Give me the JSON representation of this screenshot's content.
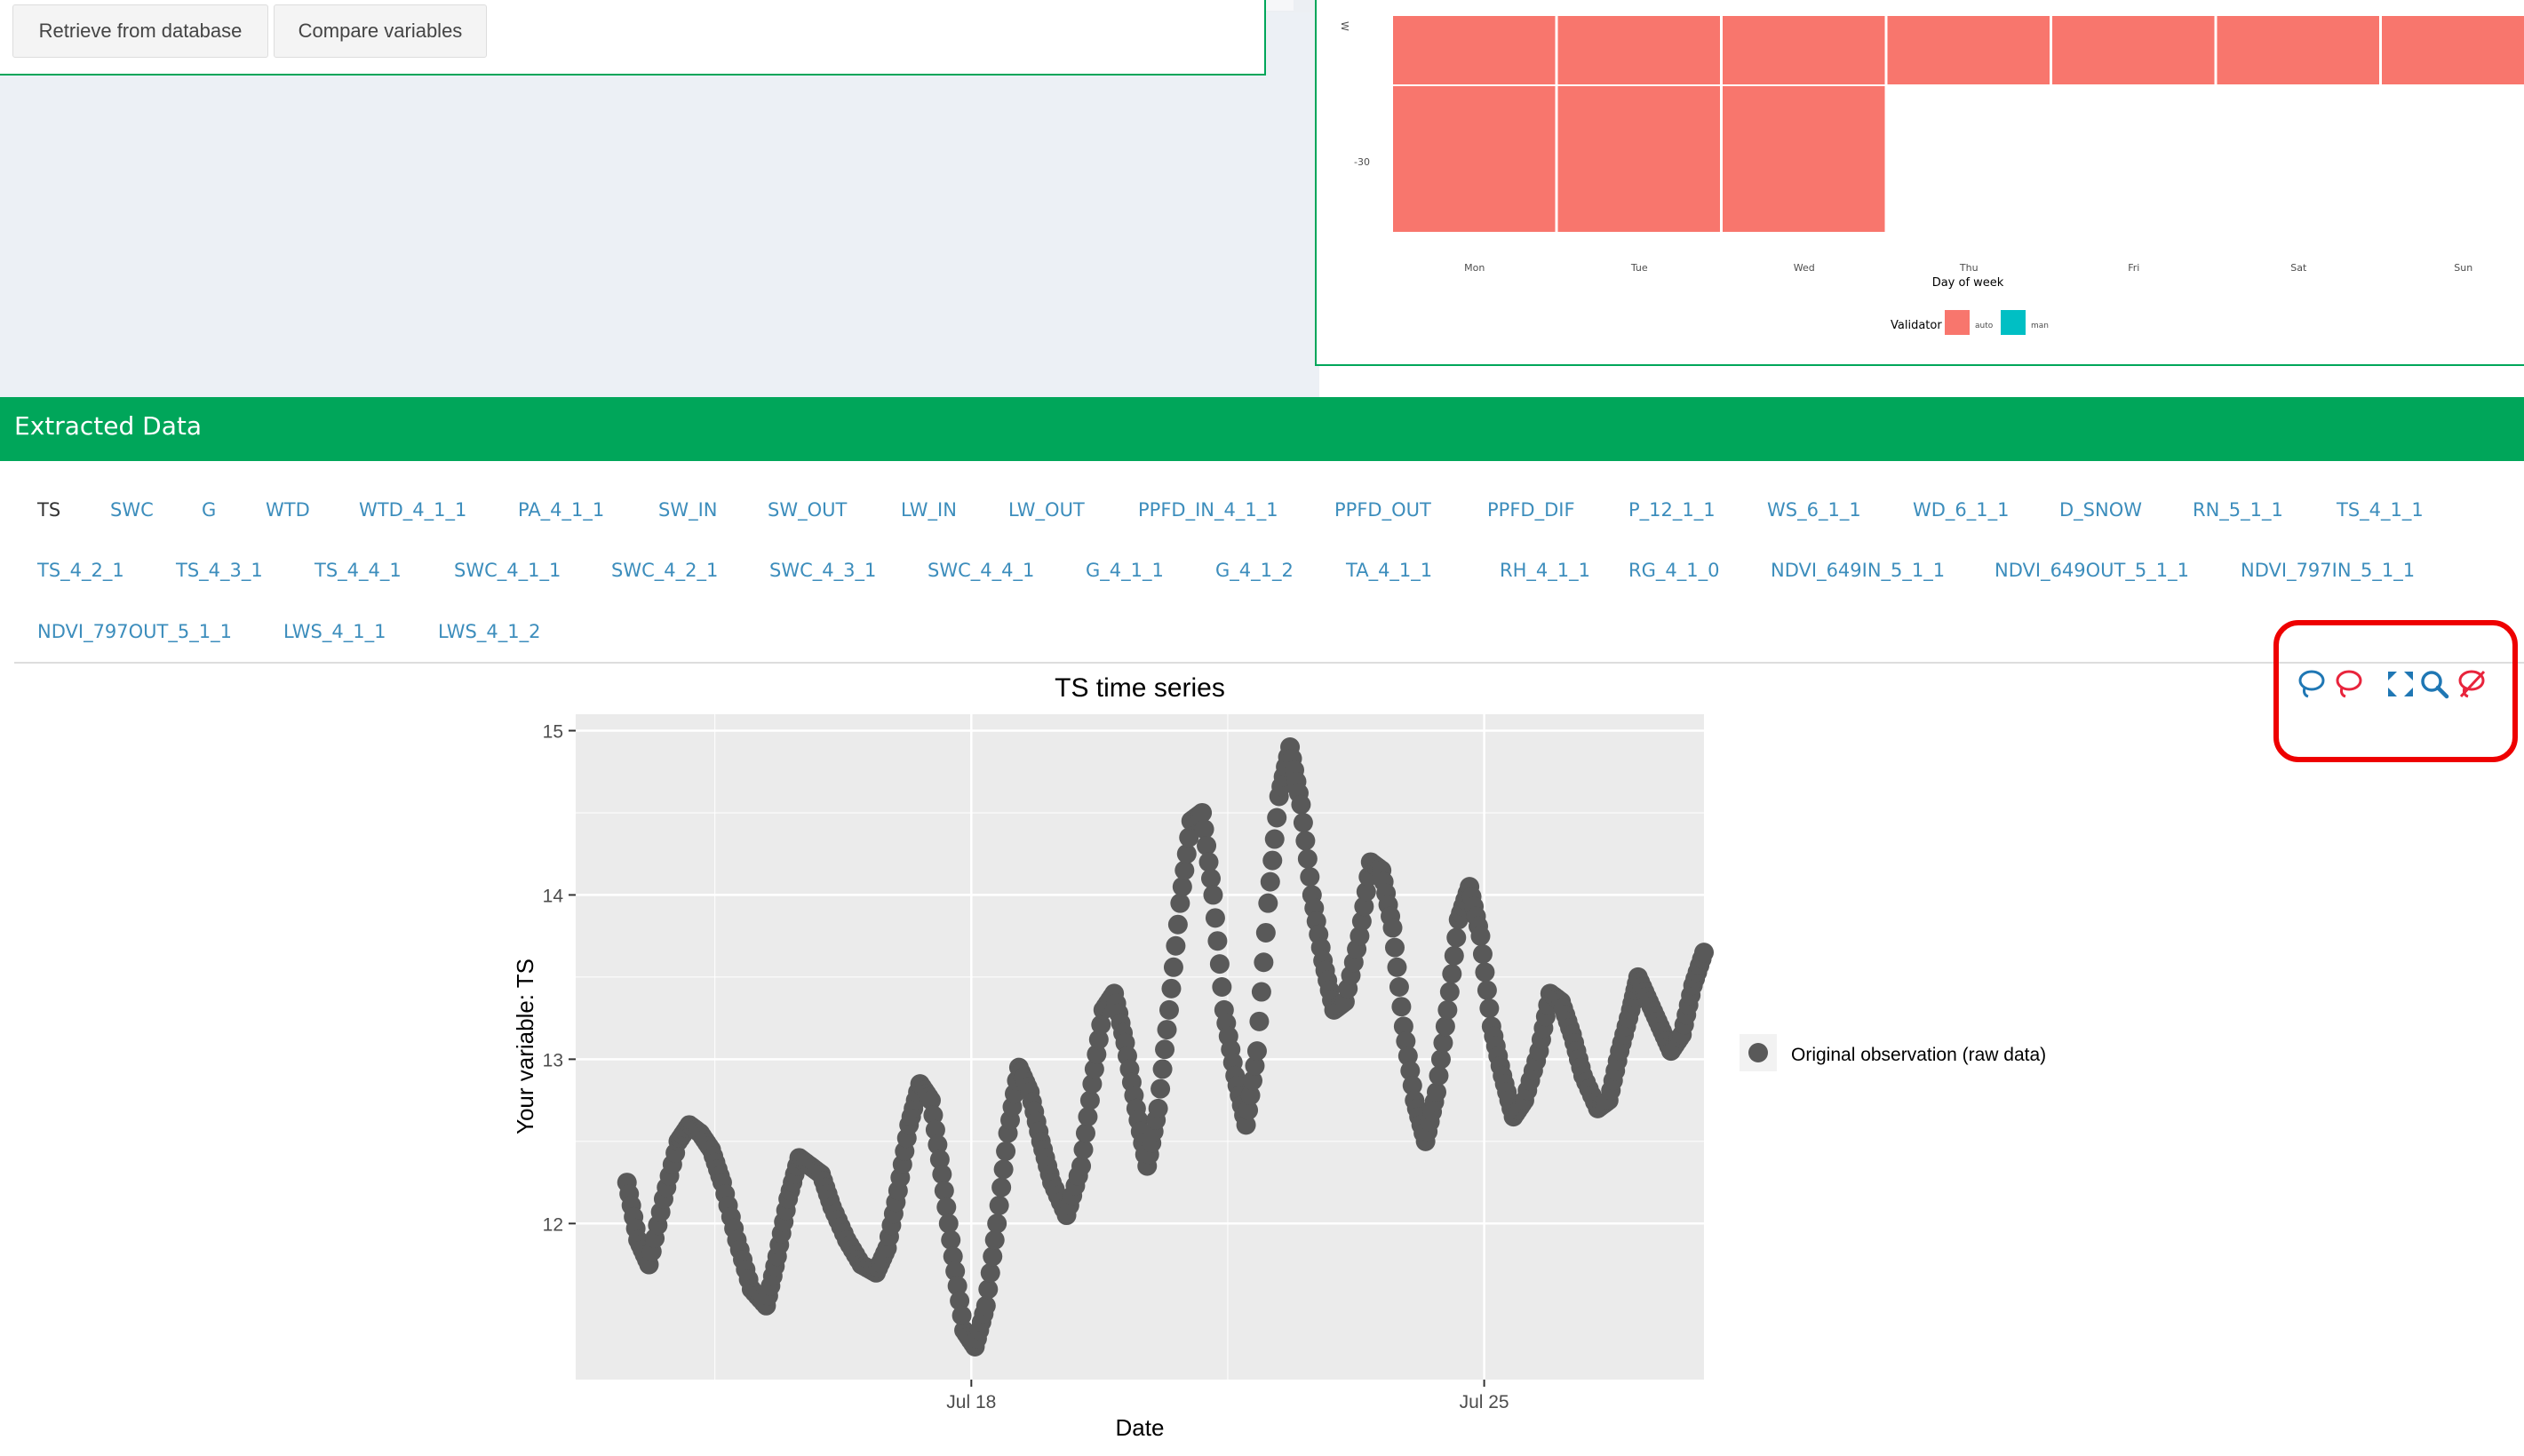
{
  "buttons": {
    "retrieve": "Retrieve from database",
    "compare": "Compare variables"
  },
  "heatmap": {
    "xlabel": "Day of week",
    "days": [
      "Mon",
      "Tue",
      "Wed",
      "Thu",
      "Fri",
      "Sat",
      "Sun"
    ],
    "ytick": "-30",
    "legend_title": "Validator",
    "legend_items": [
      {
        "label": "auto",
        "color": "#f8766d"
      },
      {
        "label": "man",
        "color": "#00bfc4"
      }
    ],
    "cell_color": "#f8766d"
  },
  "section": {
    "title": "Extracted Data"
  },
  "tabs": {
    "active": "TS",
    "row1": [
      "TS",
      "SWC",
      "G",
      "WTD",
      "WTD_4_1_1",
      "PA_4_1_1",
      "SW_IN",
      "SW_OUT",
      "LW_IN",
      "LW_OUT",
      "PPFD_IN_4_1_1",
      "PPFD_OUT",
      "PPFD_DIF",
      "P_12_1_1",
      "WS_6_1_1",
      "WD_6_1_1",
      "D_SNOW",
      "RN_5_1_1",
      "TS_4_1_1"
    ],
    "row2": [
      "TS_4_2_1",
      "TS_4_3_1",
      "TS_4_4_1",
      "SWC_4_1_1",
      "SWC_4_2_1",
      "SWC_4_3_1",
      "SWC_4_4_1",
      "G_4_1_1",
      "G_4_1_2",
      "TA_4_1_1",
      "RH_4_1_1",
      "RG_4_1_0",
      "NDVI_649IN_5_1_1",
      "NDVI_649OUT_5_1_1",
      "NDVI_797IN_5_1_1"
    ],
    "row3": [
      "NDVI_797OUT_5_1_1",
      "LWS_4_1_1",
      "LWS_4_1_2"
    ]
  },
  "toolbar": {
    "icons": [
      "lasso-select-icon",
      "lasso-deselect-icon",
      "autoscale-icon",
      "zoom-icon",
      "reset-selection-icon"
    ],
    "colors": {
      "blue": "#1f77b4",
      "red": "#e8243c"
    }
  },
  "chart_data": {
    "type": "scatter",
    "title": "TS time series",
    "xlabel": "Date",
    "ylabel": "Your variable: TS",
    "x_ticks": [
      "Jul 18",
      "Jul 25"
    ],
    "x_tick_days": [
      18,
      25
    ],
    "xlim": [
      12.6,
      28.0
    ],
    "y_ticks": [
      12,
      13,
      14,
      15
    ],
    "ylim": [
      11.05,
      15.1
    ],
    "point_color": "#595959",
    "legend": {
      "label": "Original observation (raw data)",
      "position": "right"
    },
    "series": [
      {
        "name": "Original observation (raw data)",
        "points": [
          [
            13.3,
            12.25
          ],
          [
            13.45,
            11.9
          ],
          [
            13.6,
            11.75
          ],
          [
            13.8,
            12.15
          ],
          [
            14.0,
            12.5
          ],
          [
            14.15,
            12.6
          ],
          [
            14.3,
            12.55
          ],
          [
            14.45,
            12.45
          ],
          [
            14.6,
            12.25
          ],
          [
            14.8,
            11.9
          ],
          [
            15.0,
            11.6
          ],
          [
            15.2,
            11.5
          ],
          [
            15.35,
            11.8
          ],
          [
            15.5,
            12.15
          ],
          [
            15.65,
            12.4
          ],
          [
            15.8,
            12.35
          ],
          [
            15.95,
            12.3
          ],
          [
            16.1,
            12.1
          ],
          [
            16.3,
            11.9
          ],
          [
            16.5,
            11.75
          ],
          [
            16.7,
            11.7
          ],
          [
            16.85,
            11.85
          ],
          [
            17.0,
            12.2
          ],
          [
            17.15,
            12.6
          ],
          [
            17.3,
            12.85
          ],
          [
            17.45,
            12.75
          ],
          [
            17.6,
            12.3
          ],
          [
            17.75,
            11.8
          ],
          [
            17.9,
            11.35
          ],
          [
            18.05,
            11.25
          ],
          [
            18.2,
            11.5
          ],
          [
            18.35,
            12.0
          ],
          [
            18.5,
            12.55
          ],
          [
            18.65,
            12.95
          ],
          [
            18.8,
            12.8
          ],
          [
            18.95,
            12.5
          ],
          [
            19.1,
            12.25
          ],
          [
            19.3,
            12.05
          ],
          [
            19.5,
            12.35
          ],
          [
            19.65,
            12.85
          ],
          [
            19.8,
            13.3
          ],
          [
            19.95,
            13.4
          ],
          [
            20.1,
            13.1
          ],
          [
            20.25,
            12.7
          ],
          [
            20.4,
            12.35
          ],
          [
            20.55,
            12.7
          ],
          [
            20.7,
            13.3
          ],
          [
            20.85,
            13.95
          ],
          [
            21.0,
            14.45
          ],
          [
            21.15,
            14.5
          ],
          [
            21.3,
            14.0
          ],
          [
            21.45,
            13.3
          ],
          [
            21.6,
            12.9
          ],
          [
            21.75,
            12.6
          ],
          [
            21.9,
            13.05
          ],
          [
            22.05,
            13.95
          ],
          [
            22.2,
            14.6
          ],
          [
            22.35,
            14.9
          ],
          [
            22.5,
            14.55
          ],
          [
            22.65,
            14.0
          ],
          [
            22.8,
            13.6
          ],
          [
            22.95,
            13.3
          ],
          [
            23.1,
            13.35
          ],
          [
            23.3,
            13.75
          ],
          [
            23.45,
            14.2
          ],
          [
            23.6,
            14.15
          ],
          [
            23.75,
            13.8
          ],
          [
            23.9,
            13.2
          ],
          [
            24.05,
            12.75
          ],
          [
            24.2,
            12.5
          ],
          [
            24.35,
            12.8
          ],
          [
            24.5,
            13.3
          ],
          [
            24.65,
            13.85
          ],
          [
            24.8,
            14.05
          ],
          [
            24.95,
            13.75
          ],
          [
            25.1,
            13.2
          ],
          [
            25.25,
            12.9
          ],
          [
            25.4,
            12.65
          ],
          [
            25.55,
            12.75
          ],
          [
            25.75,
            13.05
          ],
          [
            25.9,
            13.4
          ],
          [
            26.05,
            13.35
          ],
          [
            26.2,
            13.15
          ],
          [
            26.35,
            12.9
          ],
          [
            26.55,
            12.7
          ],
          [
            26.7,
            12.75
          ],
          [
            26.85,
            13.05
          ],
          [
            27.0,
            13.3
          ],
          [
            27.1,
            13.5
          ],
          [
            27.25,
            13.35
          ],
          [
            27.4,
            13.2
          ],
          [
            27.55,
            13.05
          ],
          [
            27.7,
            13.15
          ],
          [
            27.85,
            13.45
          ],
          [
            28.0,
            13.65
          ]
        ]
      }
    ]
  }
}
